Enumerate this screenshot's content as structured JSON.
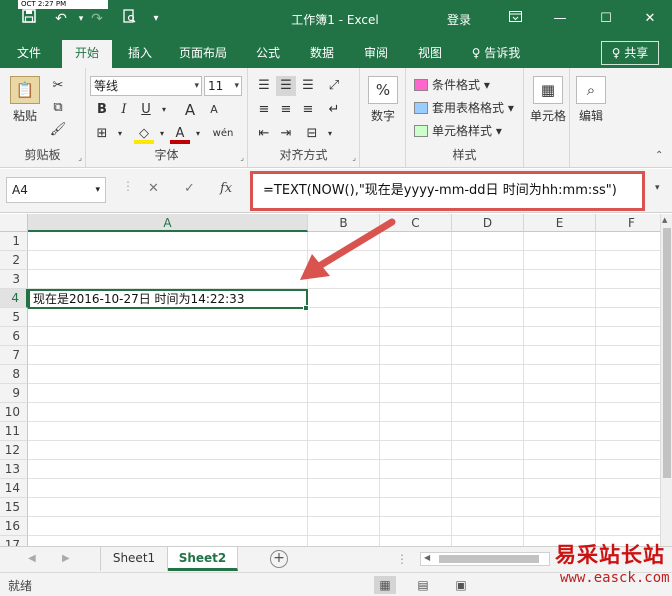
{
  "titlebar": {
    "clock": "OCT  2:27 PM",
    "title": "工作簿1 - Excel",
    "login": "登录",
    "qa_icons": [
      "save-icon",
      "undo-icon",
      "redo-icon",
      "print-preview-icon",
      "customize-icon"
    ]
  },
  "tabs": [
    {
      "label": "文件",
      "active": false
    },
    {
      "label": "开始",
      "active": true
    },
    {
      "label": "插入",
      "active": false
    },
    {
      "label": "页面布局",
      "active": false
    },
    {
      "label": "公式",
      "active": false
    },
    {
      "label": "数据",
      "active": false
    },
    {
      "label": "审阅",
      "active": false
    },
    {
      "label": "视图",
      "active": false
    },
    {
      "label": "♀ 告诉我",
      "active": false
    }
  ],
  "share": "♀ 共享",
  "ribbon": {
    "clipboard": {
      "paste": "粘贴",
      "label": "剪贴板"
    },
    "font": {
      "name": "等线",
      "size": "11",
      "label": "字体",
      "bold": "B",
      "italic": "I",
      "underline": "U",
      "grow": "A",
      "shrink": "A",
      "wen": "wén"
    },
    "alignment": {
      "label": "对齐方式"
    },
    "number": {
      "button": "数字",
      "symbol": "%"
    },
    "styles": {
      "conditional": "条件格式",
      "table": "套用表格格式",
      "cell": "单元格样式",
      "label": "样式"
    },
    "cells": {
      "button": "单元格"
    },
    "editing": {
      "button": "编辑"
    }
  },
  "formula_bar": {
    "name_box": "A4",
    "cancel": "✕",
    "enter": "✓",
    "fx": "fx",
    "formula": "=TEXT(NOW(),\"现在是yyyy-mm-dd日 时间为hh:mm:ss\")"
  },
  "grid": {
    "columns": [
      "A",
      "B",
      "C",
      "D",
      "E",
      "F"
    ],
    "rows": [
      "1",
      "2",
      "3",
      "4",
      "5",
      "6",
      "7",
      "8",
      "9",
      "10",
      "11",
      "12",
      "13",
      "14",
      "15",
      "16",
      "17"
    ],
    "selected_column": "A",
    "selected_row": "4",
    "cell_a4": "现在是2016-10-27日 时间为14:22:33"
  },
  "sheets": [
    {
      "name": "Sheet1",
      "active": false
    },
    {
      "name": "Sheet2",
      "active": true
    }
  ],
  "add_sheet": "+",
  "status": {
    "text": "就绪"
  },
  "watermark": {
    "line1": "易采站长站",
    "line2": "www.easck.com"
  }
}
